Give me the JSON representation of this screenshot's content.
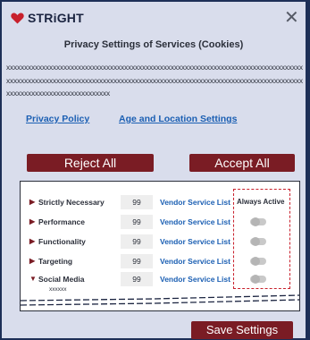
{
  "brand": {
    "name": "STRiGHT"
  },
  "dialog": {
    "title": "Privacy Settings of Services (Cookies)",
    "description": "xxxxxxxxxxxxxxxxxxxxxxxxxxxxxxxxxxxxxxxxxxxxxxxxxxxxxxxxxxxxxxxxxxxxxxxxxxxxxxxxxxxxxxxxxxxxxxxxxxxxxxxxxxxxxxxxxxxxxxxxxxxxxxxxxxxxxxxxxxxxxxxxxxxxxxxxxxxxxxxxxxxxxxxxxxxxxxxxxxxxxxxxxxxxxxxxxxx",
    "privacy_policy_label": "Privacy Policy",
    "age_location_label": "Age and Location Settings",
    "reject_label": "Reject All",
    "accept_label": "Accept All",
    "save_label": "Save Settings",
    "close_glyph": "✕"
  },
  "categories_panel": {
    "always_active_label": "Always Active",
    "rows": [
      {
        "name": "Strictly Necessary",
        "count": "99",
        "vendor_label": "Vendor Service List",
        "expanded": false,
        "toggle": null
      },
      {
        "name": "Performance",
        "count": "99",
        "vendor_label": "Vendor Service List",
        "expanded": false,
        "toggle": false
      },
      {
        "name": "Functionality",
        "count": "99",
        "vendor_label": "Vendor Service List",
        "expanded": false,
        "toggle": false
      },
      {
        "name": "Targeting",
        "count": "99",
        "vendor_label": "Vendor Service List",
        "expanded": false,
        "toggle": false
      },
      {
        "name": "Social Media",
        "count": "99",
        "vendor_label": "Vendor Service List",
        "expanded": true,
        "toggle": false
      }
    ],
    "expanded_subtext": "xxxxxx"
  },
  "colors": {
    "accent": "#7a1c24",
    "link": "#1b5fb3",
    "background": "#1d2f57",
    "dialog": "#d9ddec",
    "highlight_border": "#c8202c"
  }
}
